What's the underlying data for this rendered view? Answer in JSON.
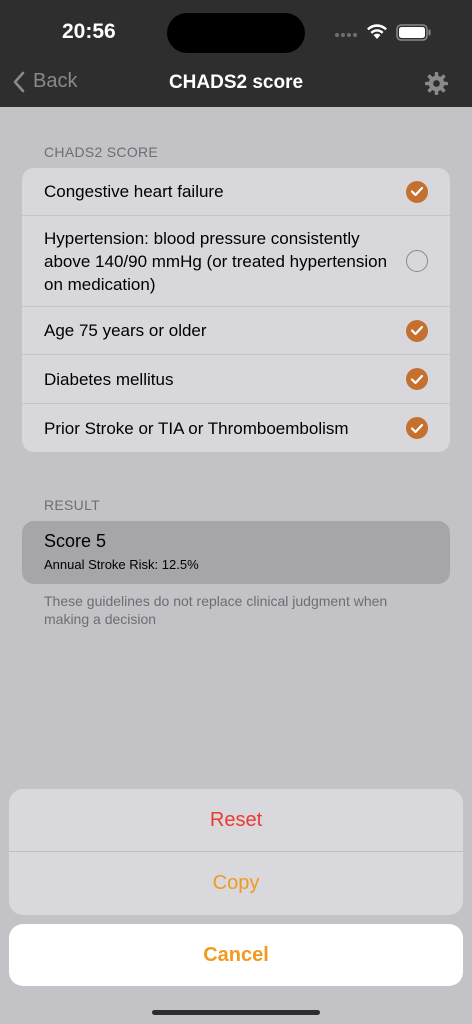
{
  "status_bar": {
    "time": "20:56"
  },
  "nav": {
    "back_label": "Back",
    "title": "CHADS2 score"
  },
  "score_section": {
    "header": "CHADS2 SCORE",
    "items": [
      {
        "label": "Congestive heart failure",
        "checked": true
      },
      {
        "label": "Hypertension: blood pressure consistently above 140/90 mmHg (or treated hypertension on medication)",
        "checked": false
      },
      {
        "label": "Age 75 years or older",
        "checked": true
      },
      {
        "label": "Diabetes mellitus",
        "checked": true
      },
      {
        "label": "Prior Stroke or TIA or Thromboembolism",
        "checked": true
      }
    ]
  },
  "result_section": {
    "header": "RESULT",
    "score": "Score 5",
    "risk": "Annual Stroke Risk: 12.5%",
    "footnote": "These guidelines do not replace clinical judgment when making a decision"
  },
  "action_sheet": {
    "reset_label": "Reset",
    "copy_label": "Copy",
    "cancel_label": "Cancel"
  },
  "colors": {
    "accent": "#f19a21",
    "check": "#c4702f",
    "destructive": "#ea3b30"
  }
}
